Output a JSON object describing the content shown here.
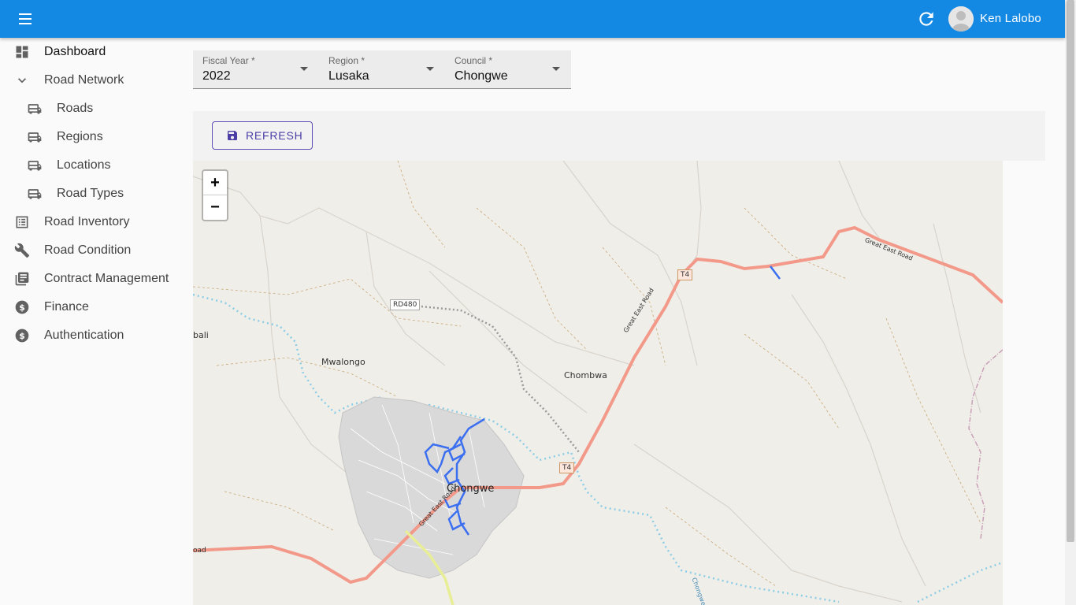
{
  "user": {
    "name": "Ken Lalobo"
  },
  "sidebar": {
    "items": [
      {
        "label": "Dashboard",
        "icon": "dashboard-icon"
      },
      {
        "label": "Road Network",
        "icon": "chevron-down-icon"
      },
      {
        "label": "Roads",
        "icon": "bus-icon"
      },
      {
        "label": "Regions",
        "icon": "bus-icon"
      },
      {
        "label": "Locations",
        "icon": "bus-icon"
      },
      {
        "label": "Road Types",
        "icon": "bus-icon"
      },
      {
        "label": "Road Inventory",
        "icon": "list-icon"
      },
      {
        "label": "Road Condition",
        "icon": "wrench-icon"
      },
      {
        "label": "Contract Management",
        "icon": "library-icon"
      },
      {
        "label": "Finance",
        "icon": "dollar-icon"
      },
      {
        "label": "Authentication",
        "icon": "dollar-icon"
      }
    ]
  },
  "filters": {
    "fiscal_year": {
      "label": "Fiscal Year *",
      "value": "2022"
    },
    "region": {
      "label": "Region *",
      "value": "Lusaka"
    },
    "council": {
      "label": "Council *",
      "value": "Chongwe"
    }
  },
  "panel": {
    "refresh_label": "REFRESH"
  },
  "map": {
    "zoom_in": "+",
    "zoom_out": "−",
    "places": {
      "mwalongo": "Mwalongo",
      "chombwa": "Chombwa",
      "chongwe": "Chongwe",
      "bali": "bali",
      "road": "oad"
    },
    "shields": {
      "t4_north": "T4",
      "t4_south": "T4",
      "rd480": "RD480"
    },
    "road_names": {
      "great_east_1": "Great East Road",
      "great_east_2": "Great East Road",
      "great_east_3": "Great East Road",
      "river": "Chongwe"
    }
  },
  "colors": {
    "appbar": "#1489e4",
    "primary_road": "#f2998a",
    "network_lines": "#3b6ff0",
    "button_accent": "#4a3ea6"
  }
}
